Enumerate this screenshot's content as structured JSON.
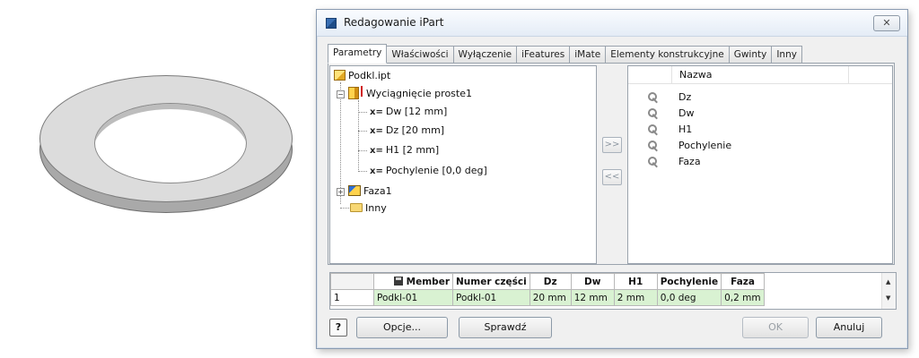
{
  "dialog": {
    "title": "Redagowanie iPart",
    "close_symbol": "✕"
  },
  "tabs": [
    {
      "label": "Parametry",
      "active": true
    },
    {
      "label": "Właściwości",
      "active": false
    },
    {
      "label": "Wyłączenie",
      "active": false
    },
    {
      "label": "iFeatures",
      "active": false
    },
    {
      "label": "iMate",
      "active": false
    },
    {
      "label": "Elementy konstrukcyjne",
      "active": false
    },
    {
      "label": "Gwinty",
      "active": false
    },
    {
      "label": "Inny",
      "active": false
    }
  ],
  "tree": {
    "root": "Podkl.ipt",
    "extrusion": "Wyciągnięcie proste1",
    "param_prefix": "x=",
    "params": [
      "Dw [12 mm]",
      "Dz [20 mm]",
      "H1 [2 mm]",
      "Pochylenie [0,0 deg]"
    ],
    "chamfer": "Faza1",
    "other": "Inny",
    "expand_symbol": "+",
    "collapse_symbol": "−"
  },
  "move_buttons": {
    "add": ">>",
    "remove": "<<"
  },
  "parameter_list": {
    "header": "Nazwa",
    "items": [
      "Dz",
      "Dw",
      "H1",
      "Pochylenie",
      "Faza"
    ]
  },
  "table": {
    "headers": [
      "Member",
      "Numer części",
      "Dz",
      "Dw",
      "H1",
      "Pochylenie",
      "Faza"
    ],
    "rows": [
      {
        "index": "1",
        "cells": [
          "Podkl-01",
          "Podkl-01",
          "20 mm",
          "12 mm",
          "2 mm",
          "0,0 deg",
          "0,2 mm"
        ]
      }
    ],
    "scroll_up": "▲",
    "scroll_down": "▼"
  },
  "buttons": {
    "help": "?",
    "options": "Opcje...",
    "check": "Sprawdź",
    "ok": "OK",
    "cancel": "Anuluj"
  }
}
